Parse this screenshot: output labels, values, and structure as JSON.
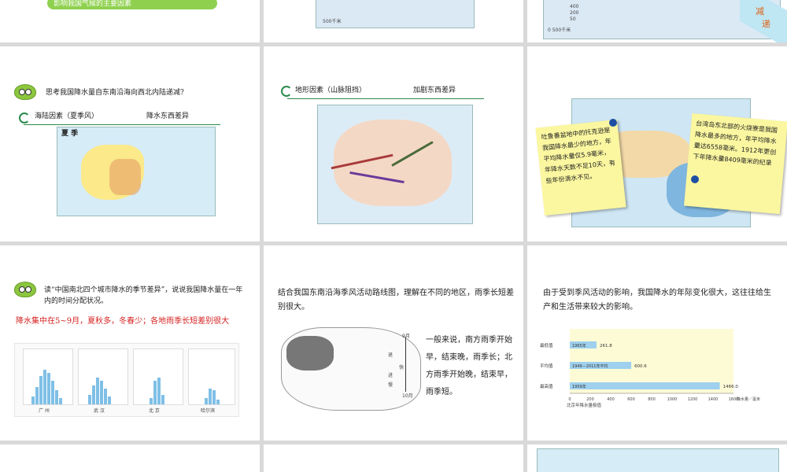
{
  "slides": {
    "s1": {
      "pill": "影响我国气候的主要因素"
    },
    "s2": {
      "scale": "500千米"
    },
    "s3": {
      "vertical": "递",
      "vertical2": "减",
      "scale": "0  500千米",
      "legend": [
        "400",
        "200",
        "50"
      ]
    },
    "s4": {
      "question": "思考我国降水量自东南沿海向西北内陆递减?",
      "factor": "海陆因素（夏季风）",
      "effect": "降水东西差异",
      "map_title": "夏 季"
    },
    "s5": {
      "factor": "地形因素（山脉阻挡）",
      "effect": "加剧东西差异"
    },
    "s6": {
      "note_left": "吐鲁番盆地中的托克逊是我国降水最少的地方，年平均降水量仅5.9毫米，年降水天数不足10天，有些年份滴水不见。",
      "note_right": "台湾岛东北部的火烧寮是我国降水最多的地方，年平均降水量达6558毫米。1912年更创下年降水量8409毫米的纪录"
    },
    "s7": {
      "question": "读“中国南北四个城市降水的季节差异”，说说我国降水量在一年内的时间分配状况。",
      "answer": "降水集中在5~9月，夏秋多，冬春少；各地雨季长短差别很大",
      "cities": [
        "广 州",
        "武 汉",
        "北 京",
        "哈尔滨"
      ]
    },
    "s8": {
      "text": "结合我国东南沿海季风活动路线图，理解在不同的地区，雨季长短差别很大。",
      "explain": "一般来说，南方雨季开始早，结束晚，雨季长；北方雨季开始晚，结束早，雨季短。",
      "labels": [
        "9月",
        "退",
        "快",
        "进",
        "慢",
        "10月"
      ]
    },
    "s9": {
      "text": "由于受到季风活动的影响，我国降水的年际变化很大，这往往给生产和生活带来较大的影响。",
      "rows": [
        {
          "label": "最低值",
          "tag": "1965年",
          "value": "261.8"
        },
        {
          "label": "平均值",
          "tag": "1949－2011年平均",
          "value": "600.6"
        },
        {
          "label": "最高值",
          "tag": "1959年",
          "value": "1466.0"
        }
      ],
      "axis_ticks": [
        "0",
        "200",
        "400",
        "600",
        "800",
        "1000",
        "1200",
        "1400",
        "1600"
      ],
      "axis_unit": "降水量／毫米",
      "caption": "北京年降水量极值"
    }
  },
  "chart_data": {
    "type": "bar",
    "title": "北京年降水量极值",
    "categories": [
      "最低值",
      "平均值",
      "最高值"
    ],
    "values": [
      261.8,
      600.6,
      1466.0
    ],
    "xlabel": "降水量／毫米",
    "xlim": [
      0,
      1600
    ]
  },
  "colors": {
    "accent_green": "#8fd14f",
    "answer_red": "#d62020",
    "note_yellow": "#fbf7a0"
  }
}
